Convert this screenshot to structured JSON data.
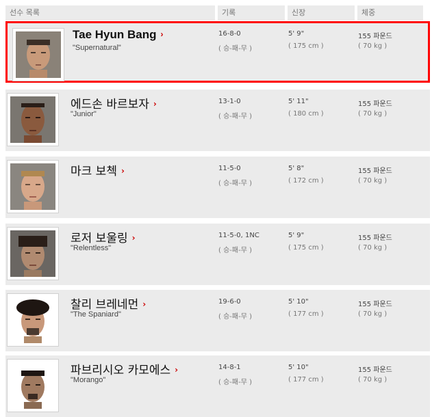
{
  "header": {
    "name_col": "선수 목록",
    "record_col": "기록",
    "height_col": "신장",
    "weight_col": "체중"
  },
  "fighters": [
    {
      "name": "Tae Hyun Bang",
      "nickname": "\"Supernatural\"",
      "record": "16-8-0",
      "record_sub": "( 승-패-무 )",
      "height": "5' 9\"",
      "height_cm": "( 175 cm )",
      "weight": "155 파운드",
      "weight_kg": "( 70 kg )"
    },
    {
      "name": "에드손 바르보자",
      "nickname": "\"Junior\"",
      "record": "13-1-0",
      "record_sub": "( 승-패-무 )",
      "height": "5' 11\"",
      "height_cm": "( 180 cm )",
      "weight": "155 파운드",
      "weight_kg": "( 70 kg )"
    },
    {
      "name": "마크 보첵",
      "nickname": "",
      "record": "11-5-0",
      "record_sub": "( 승-패-무 )",
      "height": "5' 8\"",
      "height_cm": "( 172 cm )",
      "weight": "155 파운드",
      "weight_kg": "( 70 kg )"
    },
    {
      "name": "로저 보울링",
      "nickname": "\"Relentless\"",
      "record": "11-5-0, 1NC",
      "record_sub": "( 승-패-무 )",
      "height": "5' 9\"",
      "height_cm": "( 175 cm )",
      "weight": "155 파운드",
      "weight_kg": "( 70 kg )"
    },
    {
      "name": "찰리 브레네먼",
      "nickname": "\"The Spaniard\"",
      "record": "19-6-0",
      "record_sub": "( 승-패-무 )",
      "height": "5' 10\"",
      "height_cm": "( 177 cm )",
      "weight": "155 파운드",
      "weight_kg": "( 70 kg )"
    },
    {
      "name": "파브리시오 카모에스",
      "nickname": "\"Morango\"",
      "record": "14-8-1",
      "record_sub": "( 승-패-무 )",
      "height": "5' 10\"",
      "height_cm": "( 177 cm )",
      "weight": "155 파운드",
      "weight_kg": "( 70 kg )"
    }
  ],
  "icons": {
    "arrow": "chevron-right-icon"
  },
  "colors": {
    "accent": "#cc0000",
    "highlight": "#ff0000",
    "row_bg": "#ebebeb"
  }
}
